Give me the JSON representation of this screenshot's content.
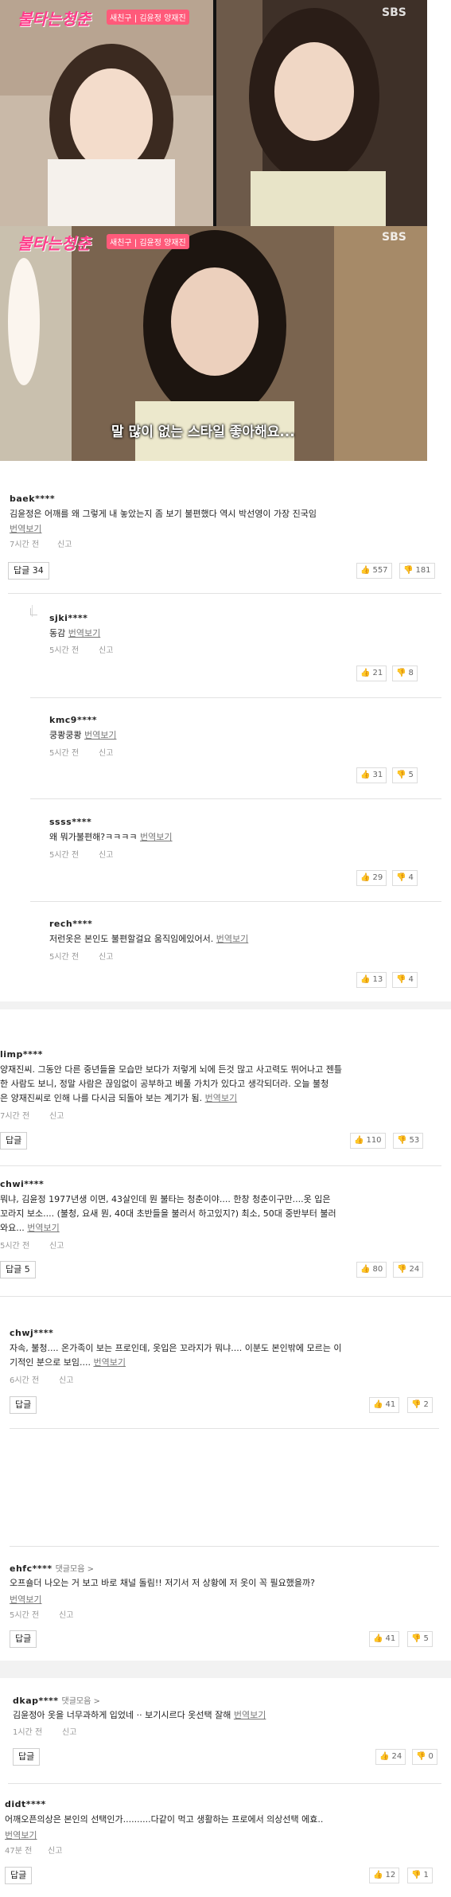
{
  "video": {
    "logo": "불타는청춘",
    "subtitle_badge": "새친구 | 김윤정 양재진",
    "network": "SBS",
    "caption": "말 많이 없는 스타일 좋아해요..."
  },
  "labels": {
    "translate": "번역보기",
    "report": "신고",
    "reply": "답글",
    "comment_collection": "댓글모음 >"
  },
  "comments": [
    {
      "id": "baek****",
      "text": "김윤정은 어깨를 왜 그렇게 내 놓았는지 좀 보기 불편했다 역시 박선영이 가장 진국임",
      "time": "7시간 전",
      "reply_label": "답글 34",
      "up": "557",
      "down": "181"
    },
    {
      "id": "sjki****",
      "text": "동감",
      "time": "5시간 전",
      "up": "21",
      "down": "8"
    },
    {
      "id": "kmc9****",
      "text": "쿵쾅쿵쾅",
      "time": "5시간 전",
      "up": "31",
      "down": "5"
    },
    {
      "id": "ssss****",
      "text": "왜 뭐가불편해?ㅋㅋㅋㅋ",
      "time": "5시간 전",
      "up": "29",
      "down": "4"
    },
    {
      "id": "rech****",
      "text": "저런옷은 본인도 불편할걸요 움직임에있어서.",
      "time": "5시간 전",
      "up": "13",
      "down": "4"
    },
    {
      "id": "limp****",
      "text1": "양재진씨. 그동안 다른 중년들을 모습만 보다가 저렇게 뇌에 든것 많고 사고력도 뛰어나고 젠틀",
      "text2": "한 사람도 보니, 정말 사람은 끊임없이 공부하고 베풀 가치가 있다고 생각되더라. 오늘 불청",
      "text3": "은 양재진씨로 인해 나를 다시금 되돌아 보는 계기가 됨.",
      "time": "7시간 전",
      "reply_label": "답글",
      "up": "110",
      "down": "53"
    },
    {
      "id": "chwi****",
      "text1": "뭐냐, 김윤정 1977년생 이면, 43살인데 뭔 불타는 청춘이야.... 한창 청춘이구만....옷 입은",
      "text2": "꼬라지 보소.... (불청, 요새 뭔, 40대 초반들을 불러서 하고있지?) 최소, 50대 중반부터 불러",
      "text3": "와요...",
      "time": "5시간 전",
      "reply_label": "답글 5",
      "up": "80",
      "down": "24"
    },
    {
      "id": "chwj****",
      "text1": "자속, 불청.... 온가족이 보는 프로인데, 옷입은 꼬라지가 뭐냐.... 이분도 본인밖에 모르는 이",
      "text2": "기적인 분으로 보임....",
      "time": "6시간 전",
      "reply_label": "답글",
      "up": "41",
      "down": "2"
    },
    {
      "id": "ehfc****",
      "text": "오프숄더 나오는 거 보고 바로 채널 돌림!! 저기서 저 상황에 저 옷이 꼭 필요했을까?",
      "time": "5시간 전",
      "reply_label": "답글",
      "up": "41",
      "down": "5"
    },
    {
      "id": "dkap****",
      "text": "김윤정아 옷을 너무과하게 입었네 ·· 보기시르다 옷선택 잘해",
      "time": "1시간 전",
      "reply_label": "답글",
      "up": "24",
      "down": "0"
    },
    {
      "id": "didt****",
      "text": "어깨오픈의상은 본인의 선택인가..........다같이 먹고 생활하는 프로에서 의상선택 에효..",
      "time": "47분 전",
      "reply_label": "답글",
      "up": "12",
      "down": "1"
    }
  ]
}
